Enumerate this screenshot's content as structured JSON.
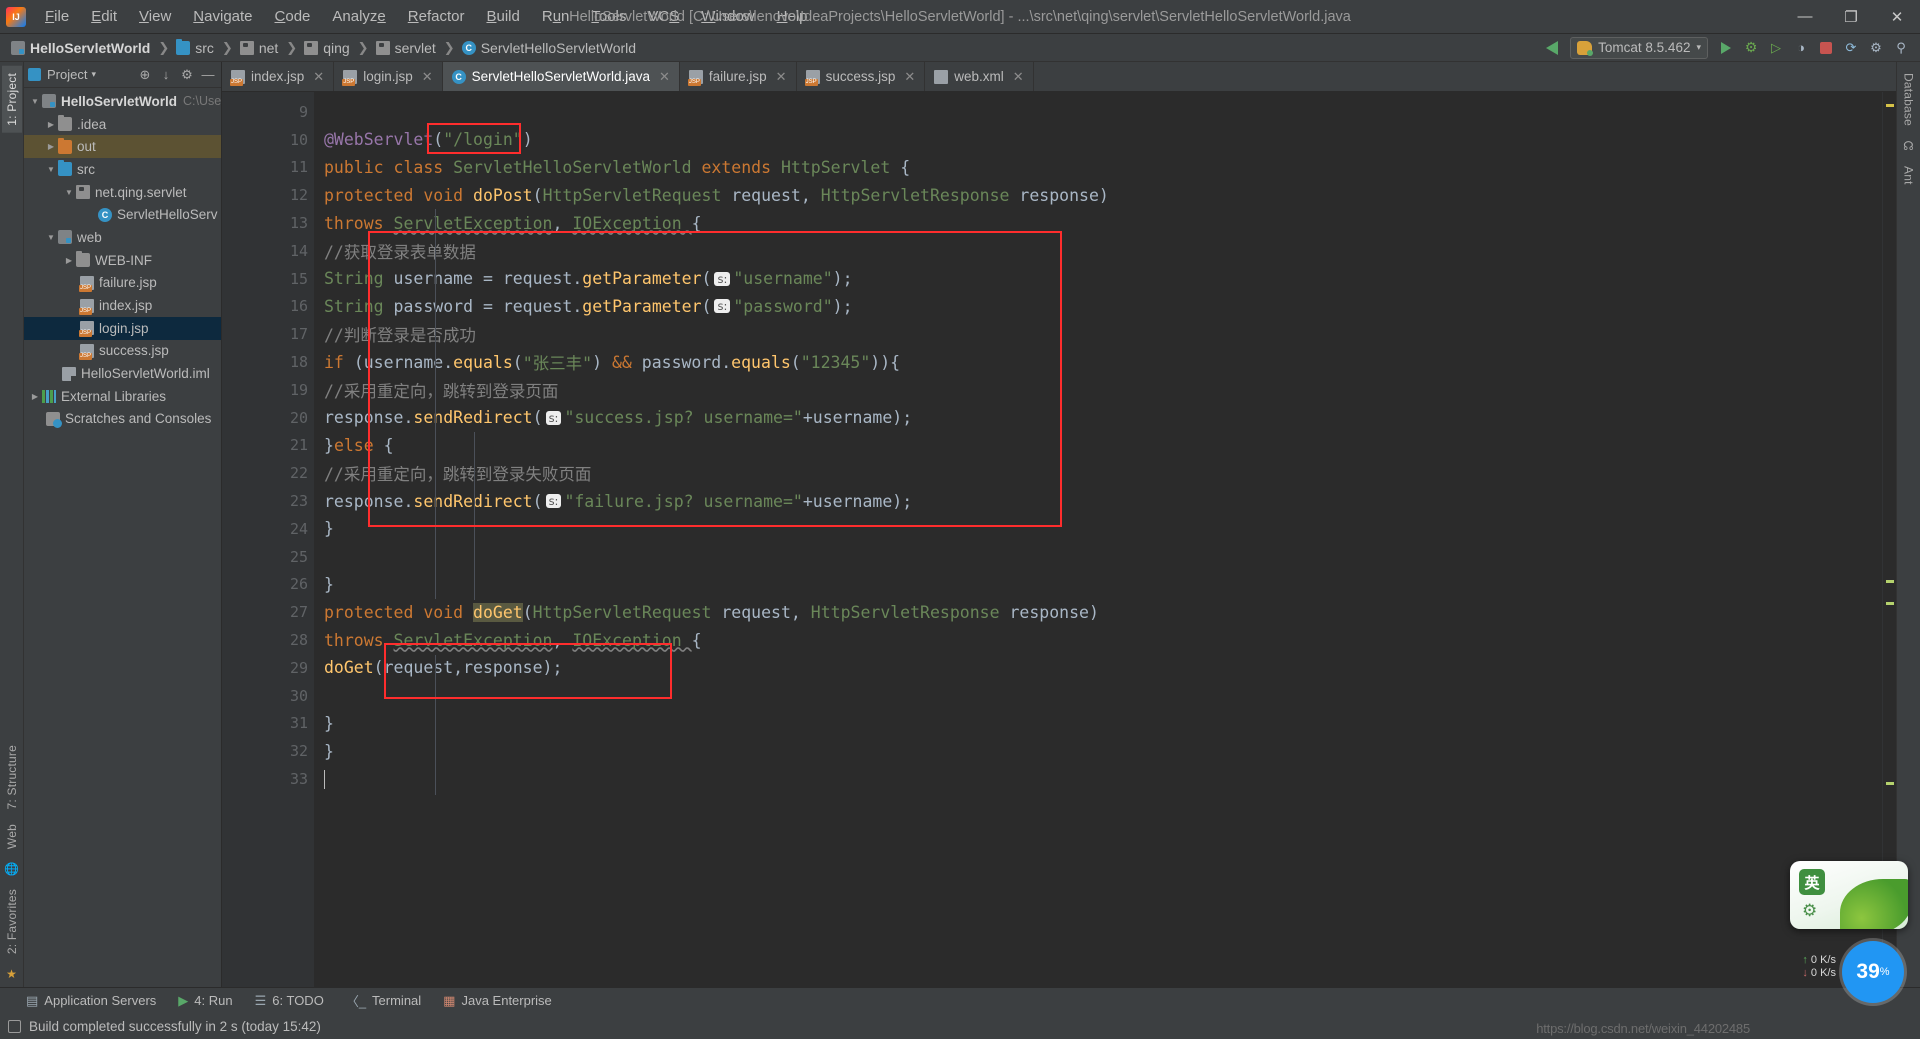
{
  "window": {
    "title": "HelloServletWorld [C:\\Users\\lenovo\\IdeaProjects\\HelloServletWorld] - ...\\src\\net\\qing\\servlet\\ServletHelloServletWorld.java",
    "minimize": "—",
    "maximize": "❐",
    "close": "✕",
    "logo_name": "intellij-idea-logo"
  },
  "menu": [
    {
      "label": "File"
    },
    {
      "label": "Edit"
    },
    {
      "label": "View"
    },
    {
      "label": "Navigate"
    },
    {
      "label": "Code"
    },
    {
      "label": "Analyze"
    },
    {
      "label": "Refactor"
    },
    {
      "label": "Build"
    },
    {
      "label": "Run"
    },
    {
      "label": "Tools"
    },
    {
      "label": "VCS"
    },
    {
      "label": "Window"
    },
    {
      "label": "Help"
    }
  ],
  "breadcrumb": [
    {
      "label": "HelloServletWorld",
      "icon": "module-icon"
    },
    {
      "label": "src",
      "icon": "folder-blue-icon"
    },
    {
      "label": "net",
      "icon": "package-icon"
    },
    {
      "label": "qing",
      "icon": "package-icon"
    },
    {
      "label": "servlet",
      "icon": "package-icon"
    },
    {
      "label": "ServletHelloServletWorld",
      "icon": "class-icon"
    }
  ],
  "toolbar": {
    "build_label": "build-hammer-icon",
    "run_config": "Tomcat 8.5.462",
    "run_config_icon": "tomcat-cat-icon",
    "dropdown": "▾",
    "buttons": [
      {
        "name": "run-button",
        "glyph": "▶"
      },
      {
        "name": "debug-button",
        "glyph": "🐞"
      },
      {
        "name": "run-with-coverage-button",
        "glyph": "▷"
      },
      {
        "name": "profile-button",
        "glyph": "◑"
      },
      {
        "name": "stop-button",
        "glyph": "■"
      },
      {
        "name": "update-application-button",
        "glyph": "↻"
      },
      {
        "name": "settings-button",
        "glyph": "⚙"
      },
      {
        "name": "search-everywhere-button",
        "glyph": "⌕"
      }
    ]
  },
  "left_rail": [
    {
      "label": "1: Project",
      "name": "rail-project",
      "active": true
    },
    {
      "label": "7: Structure",
      "name": "rail-structure"
    },
    {
      "label": "Web",
      "name": "rail-web"
    },
    {
      "label": "2: Favorites",
      "name": "rail-favorites"
    }
  ],
  "right_rail": [
    {
      "label": "Database",
      "name": "rail-database"
    },
    {
      "label": "Ant",
      "name": "rail-ant"
    }
  ],
  "project_panel": {
    "title": "Project",
    "title_dropdown": "▾",
    "buttons": [
      {
        "name": "select-opened-file-button",
        "glyph": "⊕"
      },
      {
        "name": "collapse-all-button",
        "glyph": "⤓"
      },
      {
        "name": "settings-gear-button",
        "glyph": "⚙"
      },
      {
        "name": "hide-panel-button",
        "glyph": "—"
      }
    ],
    "tree": [
      {
        "label": "HelloServletWorld",
        "sub": "C:\\Use",
        "icon": "module-icon",
        "arrow": "▼",
        "depth": 0,
        "bold": true,
        "state": "none"
      },
      {
        "label": ".idea",
        "sub": "",
        "icon": "folder-icon",
        "arrow": "▶",
        "depth": 1,
        "bold": false,
        "state": "none"
      },
      {
        "label": "out",
        "sub": "",
        "icon": "folder-orange-icon",
        "arrow": "▶",
        "depth": 1,
        "bold": false,
        "state": "hl"
      },
      {
        "label": "src",
        "sub": "",
        "icon": "folder-blue-icon",
        "arrow": "▼",
        "depth": 1,
        "bold": false,
        "state": "none"
      },
      {
        "label": "net.qing.servlet",
        "sub": "",
        "icon": "package-icon",
        "arrow": "▼",
        "depth": 2,
        "bold": false,
        "state": "none"
      },
      {
        "label": "ServletHelloServ",
        "sub": "",
        "icon": "class-icon",
        "arrow": "",
        "depth": 3,
        "bold": false,
        "state": "none"
      },
      {
        "label": "web",
        "sub": "",
        "icon": "web-folder-icon",
        "arrow": "▼",
        "depth": 1,
        "bold": false,
        "state": "none"
      },
      {
        "label": "WEB-INF",
        "sub": "",
        "icon": "folder-icon",
        "arrow": "▶",
        "depth": 2,
        "bold": false,
        "state": "none"
      },
      {
        "label": "failure.jsp",
        "sub": "",
        "icon": "jsp-icon",
        "arrow": "",
        "depth": 2,
        "bold": false,
        "state": "none"
      },
      {
        "label": "index.jsp",
        "sub": "",
        "icon": "jsp-icon",
        "arrow": "",
        "depth": 2,
        "bold": false,
        "state": "none"
      },
      {
        "label": "login.jsp",
        "sub": "",
        "icon": "jsp-icon",
        "arrow": "",
        "depth": 2,
        "bold": false,
        "state": "sel"
      },
      {
        "label": "success.jsp",
        "sub": "",
        "icon": "jsp-icon",
        "arrow": "",
        "depth": 2,
        "bold": false,
        "state": "none"
      },
      {
        "label": "HelloServletWorld.iml",
        "sub": "",
        "icon": "iml-icon",
        "arrow": "",
        "depth": 1,
        "bold": false,
        "state": "none"
      },
      {
        "label": "External Libraries",
        "sub": "",
        "icon": "external-libraries-icon",
        "arrow": "▶",
        "depth": 0,
        "bold": false,
        "state": "none"
      },
      {
        "label": "Scratches and Consoles",
        "sub": "",
        "icon": "scratches-icon",
        "arrow": "",
        "depth": 0,
        "bold": false,
        "state": "none"
      }
    ]
  },
  "editor_tabs": [
    {
      "label": "index.jsp",
      "icon": "jsp-icon",
      "active": false
    },
    {
      "label": "login.jsp",
      "icon": "jsp-icon",
      "active": false
    },
    {
      "label": "ServletHelloServletWorld.java",
      "icon": "class-icon",
      "active": true
    },
    {
      "label": "failure.jsp",
      "icon": "jsp-icon",
      "active": false
    },
    {
      "label": "success.jsp",
      "icon": "jsp-icon",
      "active": false
    },
    {
      "label": "web.xml",
      "icon": "xml-icon",
      "active": false
    }
  ],
  "editor": {
    "first_line_number": 9,
    "last_line_number": 33,
    "lines": [
      {
        "n": 9,
        "text": ""
      },
      {
        "n": 10,
        "text": "@WebServlet(\"/login\")"
      },
      {
        "n": 11,
        "text": "public class ServletHelloServletWorld extends HttpServlet {"
      },
      {
        "n": 12,
        "text": "    protected void doPost(HttpServletRequest request, HttpServletResponse response)"
      },
      {
        "n": 13,
        "text": "            throws ServletException, IOException {"
      },
      {
        "n": 14,
        "text": "        //获取登录表单数据"
      },
      {
        "n": 15,
        "text": "        String username = request.getParameter( s: \"username\");"
      },
      {
        "n": 16,
        "text": "        String password = request.getParameter( s: \"password\");"
      },
      {
        "n": 17,
        "text": "        //判断登录是否成功"
      },
      {
        "n": 18,
        "text": "        if (username.equals(\"张三丰\") && password.equals(\"12345\")){"
      },
      {
        "n": 19,
        "text": "            //采用重定向，跳转到登录页面"
      },
      {
        "n": 20,
        "text": "            response.sendRedirect( s: \"success.jsp? username=\"+username);"
      },
      {
        "n": 21,
        "text": "        }else {"
      },
      {
        "n": 22,
        "text": "            //采用重定向，跳转到登录失败页面"
      },
      {
        "n": 23,
        "text": "            response.sendRedirect( s: \"failure.jsp? username=\"+username);"
      },
      {
        "n": 24,
        "text": "        }"
      },
      {
        "n": 25,
        "text": ""
      },
      {
        "n": 26,
        "text": "    }"
      },
      {
        "n": 27,
        "text": "    protected void doGet(HttpServletRequest request, HttpServletResponse response)"
      },
      {
        "n": 28,
        "text": "            throws ServletException, IOException {"
      },
      {
        "n": 29,
        "text": "        doGet(request,response);"
      },
      {
        "n": 30,
        "text": ""
      },
      {
        "n": 31,
        "text": "    }"
      },
      {
        "n": 32,
        "text": "}"
      },
      {
        "n": 33,
        "text": ""
      }
    ],
    "parameter_hint": "s:",
    "annotations": [
      {
        "name": "red-highlight-box-webservlet-path"
      },
      {
        "name": "red-highlight-box-dopost-body"
      },
      {
        "name": "red-highlight-box-doget-call"
      }
    ]
  },
  "bottom_tools": [
    {
      "label": "Application Servers",
      "icon": "application-servers-icon",
      "mnemonic": ""
    },
    {
      "label": "4: Run",
      "icon": "run-icon",
      "mnemonic": "4"
    },
    {
      "label": "6: TODO",
      "icon": "todo-icon",
      "mnemonic": "6"
    },
    {
      "label": "Terminal",
      "icon": "terminal-icon",
      "mnemonic": ""
    },
    {
      "label": "Java Enterprise",
      "icon": "java-enterprise-icon",
      "mnemonic": ""
    }
  ],
  "statusbar": {
    "message": "Build completed successfully in 2 s (today 15:42)",
    "watermark": "https://blog.csdn.net/weixin_44202485"
  },
  "widgets": {
    "ime_label": "英",
    "ime_gear": "⚙",
    "net_up": "0  K/s",
    "net_down": "0  K/s",
    "net_up_arrow": "↑",
    "net_down_arrow": "↓",
    "battery": "39",
    "battery_unit": "%"
  },
  "colors": {
    "accent_blue": "#3592c4",
    "selection": "#0d293e",
    "highlight_box": "#ff2d2d",
    "keyword": "#cc7832",
    "string": "#6a8759",
    "comment": "#808080",
    "function": "#ffc66d",
    "class_name": "#4fc1ff",
    "annotation": "#bbb529"
  }
}
